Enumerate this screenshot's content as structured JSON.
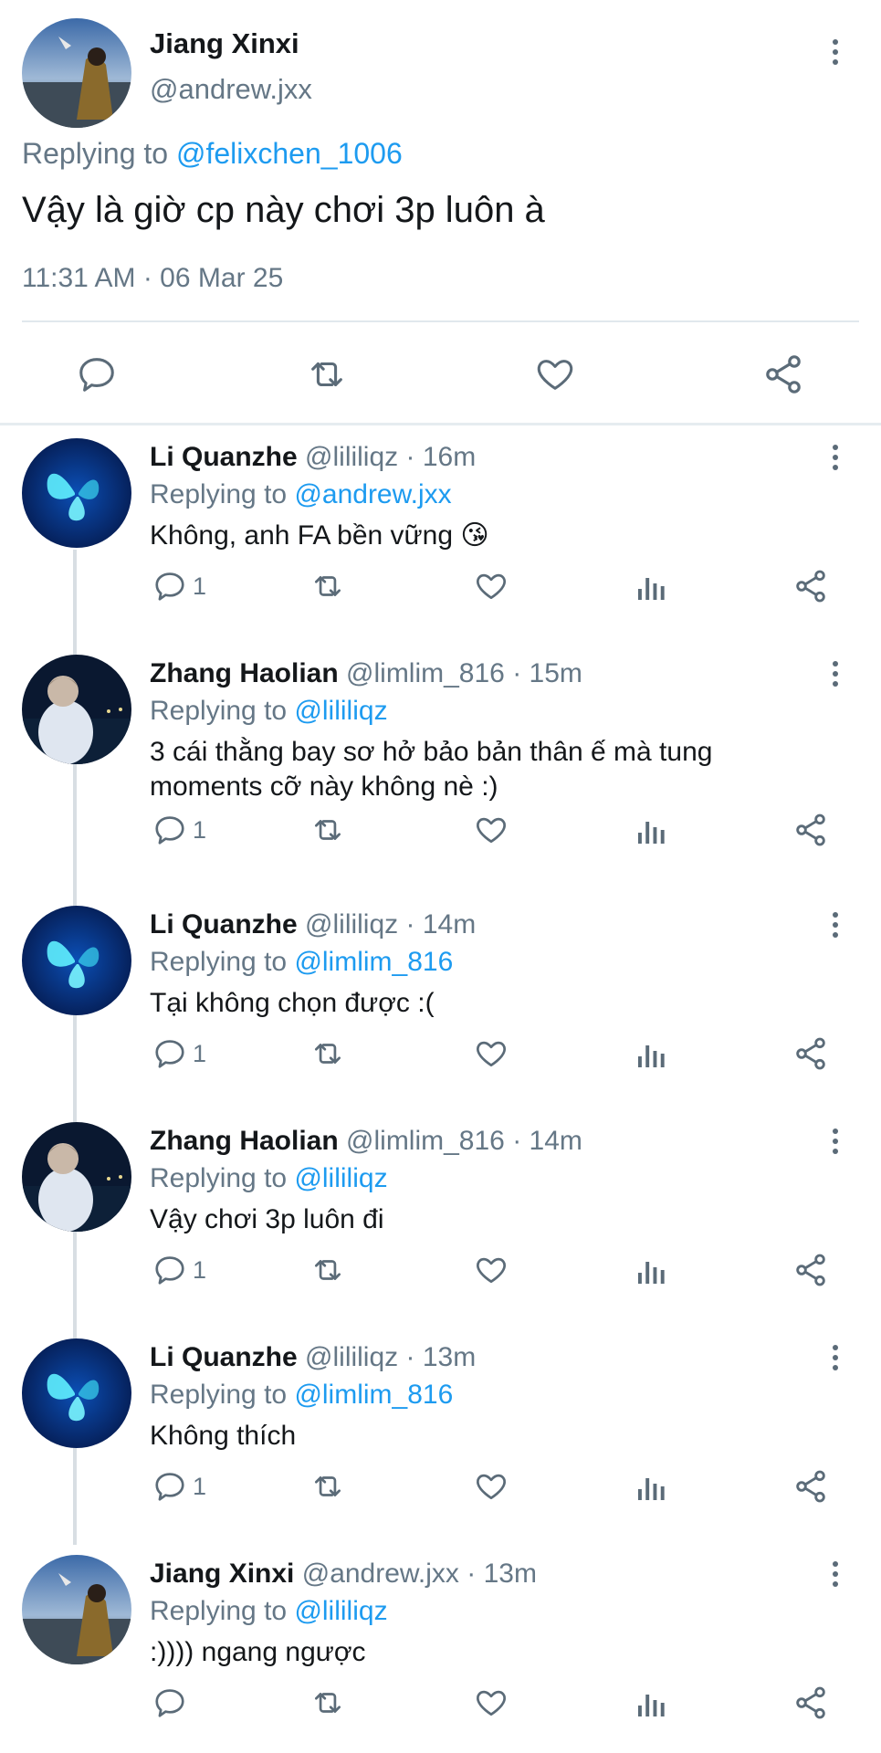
{
  "main_tweet": {
    "author_name": "Jiang Xinxi",
    "author_handle": "@andrew.jxx",
    "replying_prefix": "Replying to",
    "replying_to": "@felixchen_1006",
    "text": "Vậy là giờ cp này chơi 3p luôn à",
    "timestamp": "11:31 AM · 06 Mar 25"
  },
  "replies": [
    {
      "name": "Li Quanzhe",
      "handle": "@lililiqz",
      "time": "· 16m",
      "replying_prefix": "Replying to",
      "replying_to": "@andrew.jxx",
      "text": "Không, anh FA bền vững 😘",
      "reply_count": "1"
    },
    {
      "name": "Zhang Haolian",
      "handle": "@limlim_816",
      "time": "· 15m",
      "replying_prefix": "Replying to",
      "replying_to": "@lililiqz",
      "text": "3 cái thằng bay sơ hở bảo bản thân ế mà tung moments cỡ này không nè :)",
      "reply_count": "1"
    },
    {
      "name": "Li Quanzhe",
      "handle": "@lililiqz",
      "time": "· 14m",
      "replying_prefix": "Replying to",
      "replying_to": "@limlim_816",
      "text": "Tại không chọn được :(",
      "reply_count": "1"
    },
    {
      "name": "Zhang Haolian",
      "handle": "@limlim_816",
      "time": "· 14m",
      "replying_prefix": "Replying to",
      "replying_to": "@lililiqz",
      "text": "Vậy chơi 3p luôn đi",
      "reply_count": "1"
    },
    {
      "name": "Li Quanzhe",
      "handle": "@lililiqz",
      "time": "· 13m",
      "replying_prefix": "Replying to",
      "replying_to": "@limlim_816",
      "text": "Không thích",
      "reply_count": "1"
    },
    {
      "name": "Jiang Xinxi",
      "handle": "@andrew.jxx",
      "time": "· 13m",
      "replying_prefix": "Replying to",
      "replying_to": "@lililiqz",
      "text": ":)))) ngang ngược",
      "reply_count": ""
    }
  ],
  "icons": {
    "reply": "speech-bubble-icon",
    "retweet": "retweet-icon",
    "like": "heart-icon",
    "stats": "bar-chart-icon",
    "share": "share-icon",
    "more": "kebab-menu-icon"
  },
  "colors": {
    "accent": "#1d9bf0",
    "muted": "#657786",
    "text": "#14171a",
    "divider": "#e6ecf0"
  }
}
